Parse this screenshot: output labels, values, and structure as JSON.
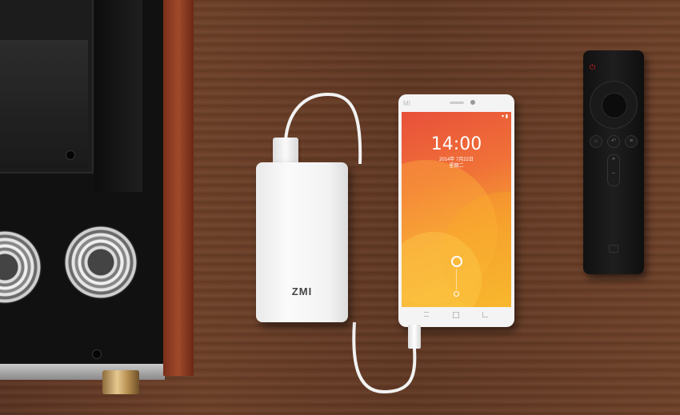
{
  "scene": {
    "background": "dark walnut wooden table",
    "colors": {
      "wood": "#633a25",
      "amp_wood": "#a04a2a",
      "screen_top": "#e8503a",
      "screen_bottom": "#f7c030",
      "power_led": "#dd2222"
    }
  },
  "power_bank": {
    "brand": "ZMI"
  },
  "phone": {
    "brand": "MI",
    "lock_screen": {
      "time": "14:00",
      "date": "2014年 7月22日",
      "weekday": "星期二"
    }
  },
  "remote": {
    "icons": [
      "power-icon",
      "dpad-icon",
      "home-icon",
      "back-icon",
      "menu-icon",
      "volume-icon"
    ]
  }
}
